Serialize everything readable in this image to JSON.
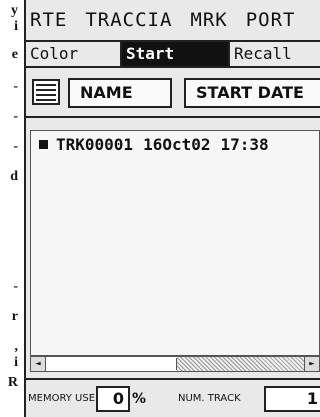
{
  "doc_strip": [
    "y",
    "i",
    "e",
    "-",
    "-",
    "-",
    "d",
    "-",
    "r",
    ",",
    "i",
    "R"
  ],
  "menubar": {
    "items": [
      "RTE",
      "TRACCIA",
      "MRK",
      "PORT"
    ]
  },
  "softkeys": {
    "color": "Color",
    "start": "Start",
    "recall": "Recall"
  },
  "header": {
    "name": "NAME",
    "start_date": "START DATE",
    "icon": "grid-list-icon"
  },
  "tracks": [
    {
      "name": "TRK00001",
      "date": "16Oct02",
      "time": "17:38"
    }
  ],
  "scrollbar": {
    "left_arrow": "◄",
    "right_arrow": "►"
  },
  "footer": {
    "memory_label": "MEMORY USED",
    "memory_value": "0",
    "percent": "%",
    "track_label": "NUM. TRACK",
    "track_value": "1"
  },
  "colors": {
    "background": "#e9e9e9",
    "selected": "#111111"
  }
}
